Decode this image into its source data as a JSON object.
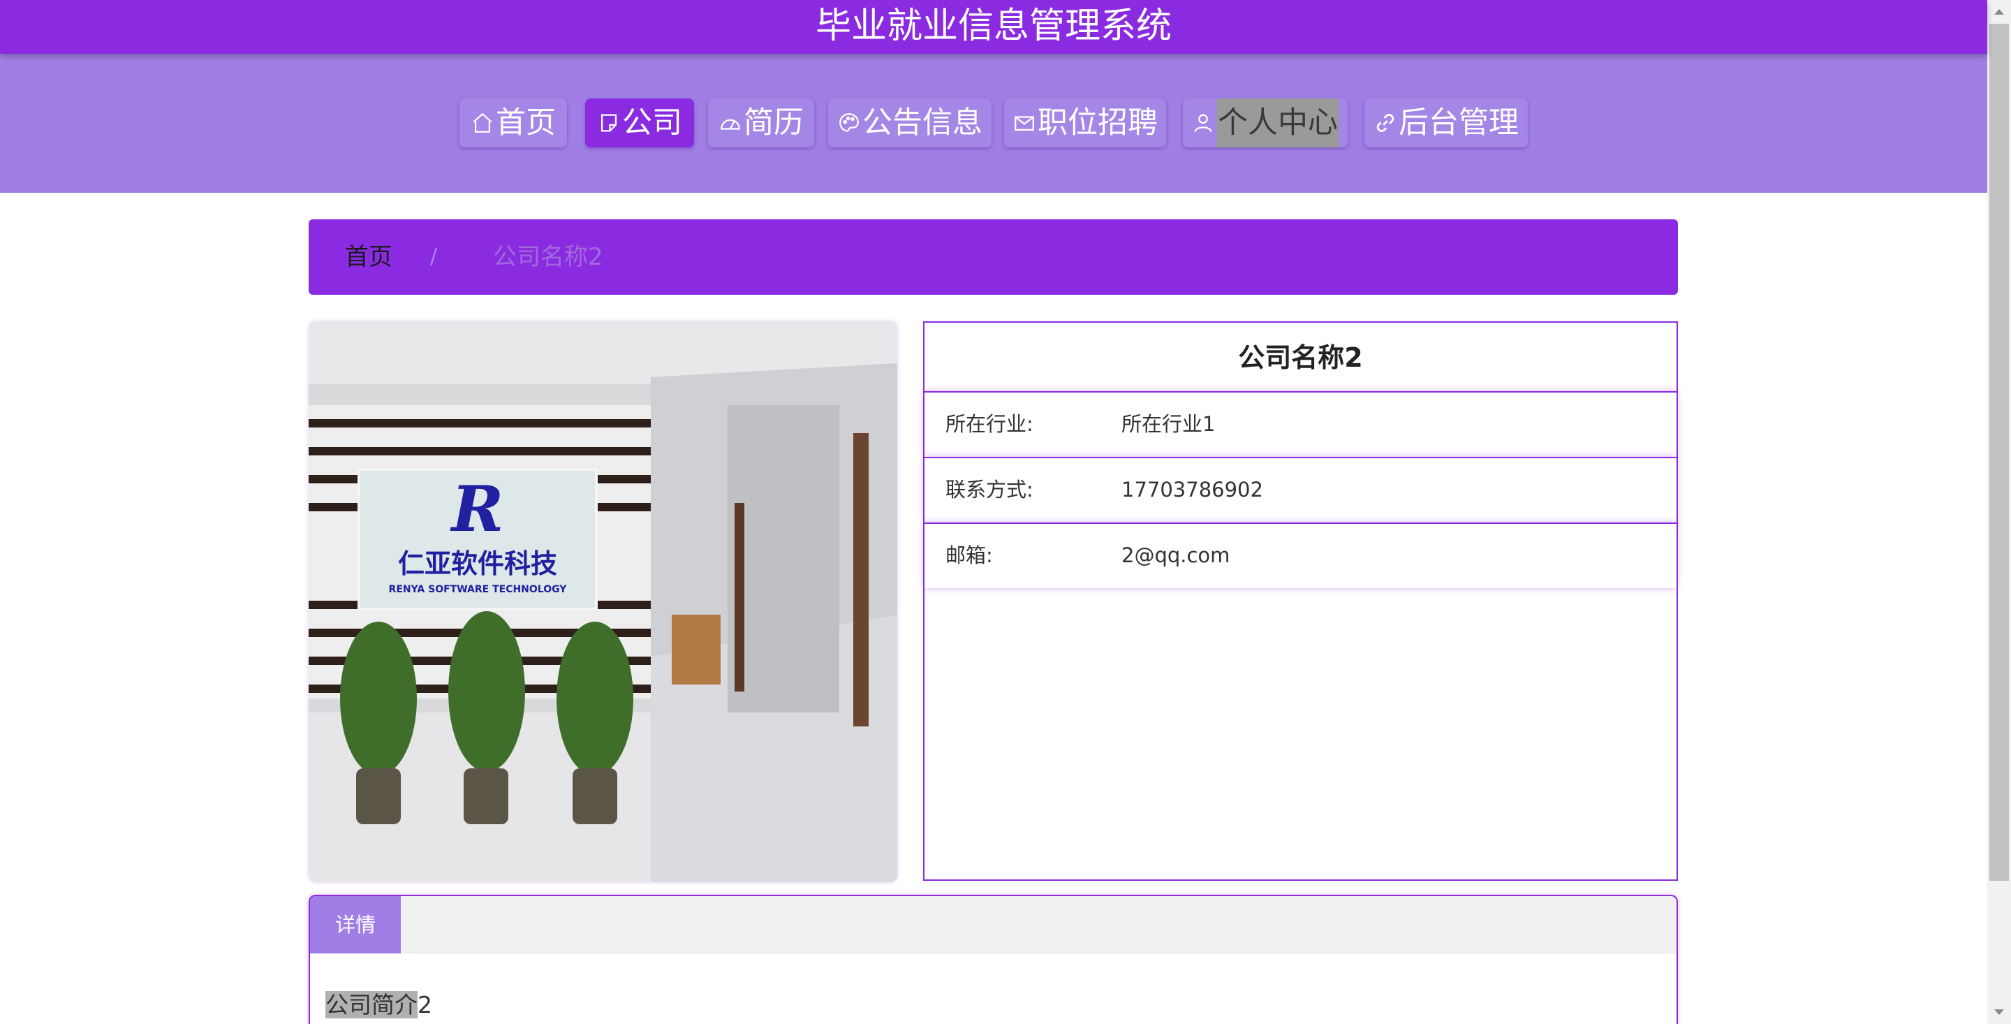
{
  "app": {
    "title": "毕业就业信息管理系统"
  },
  "nav": {
    "items": [
      {
        "label": "首页",
        "icon": "home-icon"
      },
      {
        "label": "公司",
        "icon": "document-icon"
      },
      {
        "label": "简历",
        "icon": "dashboard-icon"
      },
      {
        "label": "公告信息",
        "icon": "palette-icon"
      },
      {
        "label": "职位招聘",
        "icon": "mail-icon"
      },
      {
        "label": "个人中心",
        "icon": "user-icon"
      },
      {
        "label": "后台管理",
        "icon": "link-icon"
      }
    ],
    "active_index": 1
  },
  "breadcrumb": {
    "home": "首页",
    "separator": "/",
    "current": "公司名称2"
  },
  "image": {
    "logo_text": "仁亚软件科技",
    "logo_subtext": "RENYA SOFTWARE TECHNOLOGY"
  },
  "company": {
    "name": "公司名称2",
    "fields": [
      {
        "label": "所在行业:",
        "value": "所在行业1"
      },
      {
        "label": "联系方式:",
        "value": "17703786902"
      },
      {
        "label": "邮箱:",
        "value": "2@qq.com"
      }
    ]
  },
  "details": {
    "tab_label": "详情",
    "intro_selected": "公司简介",
    "intro_rest": "2"
  },
  "colors": {
    "primary": "#8a2be2",
    "nav_band": "#a07ee6",
    "nav_button": "#a486e6"
  }
}
